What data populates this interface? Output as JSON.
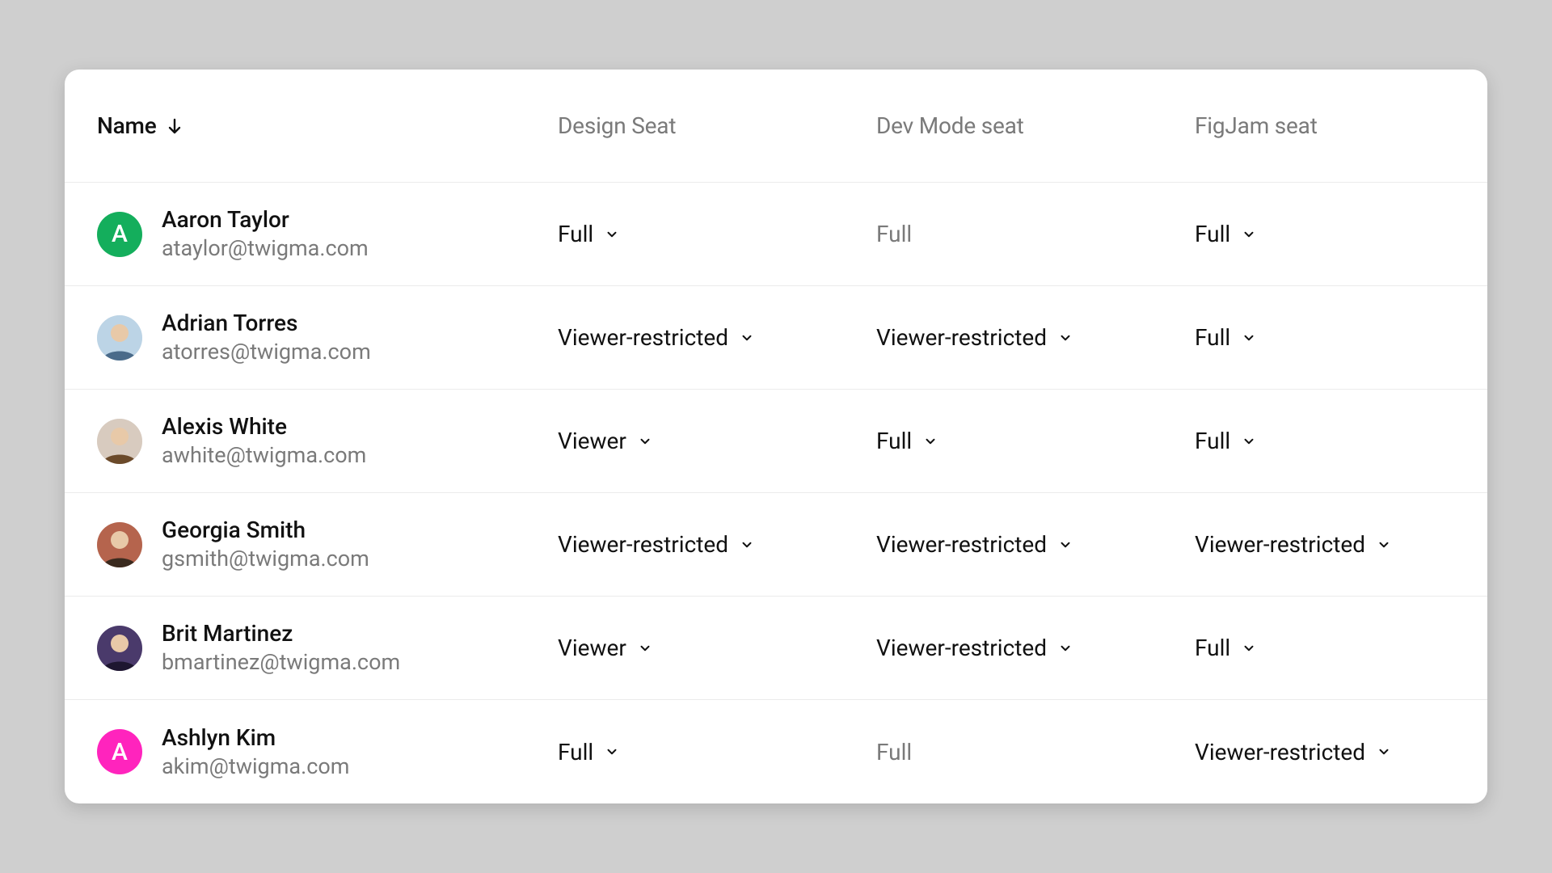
{
  "columns": {
    "name": "Name",
    "design": "Design Seat",
    "dev": "Dev Mode seat",
    "figjam": "FigJam seat"
  },
  "sort": {
    "column": "name",
    "direction": "desc"
  },
  "rows": [
    {
      "name": "Aaron Taylor",
      "email": "ataylor@twigma.com",
      "avatar": {
        "kind": "letter",
        "letter": "A",
        "color": "green"
      },
      "design": {
        "value": "Full",
        "editable": true
      },
      "dev": {
        "value": "Full",
        "editable": false
      },
      "figjam": {
        "value": "Full",
        "editable": true
      }
    },
    {
      "name": "Adrian Torres",
      "email": "atorres@twigma.com",
      "avatar": {
        "kind": "photo",
        "variant": 1
      },
      "design": {
        "value": "Viewer-restricted",
        "editable": true
      },
      "dev": {
        "value": "Viewer-restricted",
        "editable": true
      },
      "figjam": {
        "value": "Full",
        "editable": true
      }
    },
    {
      "name": "Alexis White",
      "email": "awhite@twigma.com",
      "avatar": {
        "kind": "photo",
        "variant": 2
      },
      "design": {
        "value": "Viewer",
        "editable": true
      },
      "dev": {
        "value": "Full",
        "editable": true
      },
      "figjam": {
        "value": "Full",
        "editable": true
      }
    },
    {
      "name": "Georgia Smith",
      "email": "gsmith@twigma.com",
      "avatar": {
        "kind": "photo",
        "variant": 3
      },
      "design": {
        "value": "Viewer-restricted",
        "editable": true
      },
      "dev": {
        "value": "Viewer-restricted",
        "editable": true
      },
      "figjam": {
        "value": "Viewer-restricted",
        "editable": true
      }
    },
    {
      "name": "Brit Martinez",
      "email": "bmartinez@twigma.com",
      "avatar": {
        "kind": "photo",
        "variant": 4
      },
      "design": {
        "value": "Viewer",
        "editable": true
      },
      "dev": {
        "value": "Viewer-restricted",
        "editable": true
      },
      "figjam": {
        "value": "Full",
        "editable": true
      }
    },
    {
      "name": "Ashlyn Kim",
      "email": "akim@twigma.com",
      "avatar": {
        "kind": "letter",
        "letter": "A",
        "color": "pink"
      },
      "design": {
        "value": "Full",
        "editable": true
      },
      "dev": {
        "value": "Full",
        "editable": false
      },
      "figjam": {
        "value": "Viewer-restricted",
        "editable": true
      }
    }
  ]
}
